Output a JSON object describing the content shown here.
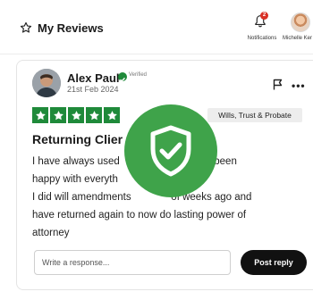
{
  "header": {
    "title": "My Reviews",
    "title_icon": "star-outline-icon",
    "notifications": {
      "label": "Notifications",
      "badge": "2",
      "icon": "bell-icon"
    },
    "profile": {
      "label": "Michelle Ker"
    }
  },
  "review": {
    "reviewer_name": "Alex Paul",
    "verified_label": "Verified",
    "date": "21st Feb 2024",
    "rating": 5,
    "category": "Wills, Trust & Probate",
    "title": "Returning Clier",
    "body_lines": [
      "I have always used                  e always been",
      "happy with everyth",
      "I did will amendments              of weeks ago and",
      "have returned again to now do lasting power of",
      "attorney"
    ],
    "overlay_icon": "shield-check-icon"
  },
  "response": {
    "placeholder": "Write a response...",
    "post_label": "Post reply"
  },
  "colors": {
    "star_green": "#1f8a3a",
    "shield_green": "#3fa34a",
    "button_dark": "#111111",
    "badge_red": "#d93025"
  }
}
